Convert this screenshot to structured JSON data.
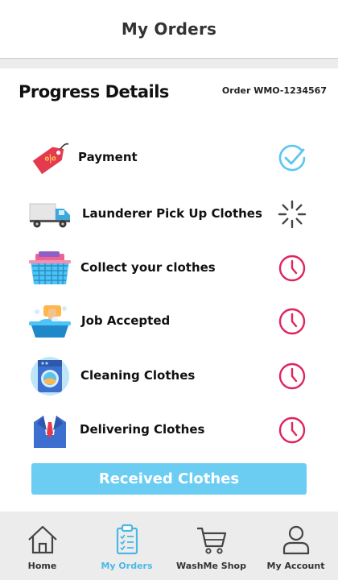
{
  "header": {
    "title": "My Orders"
  },
  "progress": {
    "title": "Progress Details",
    "order_id": "Order WMO-1234567",
    "steps": [
      {
        "label": "Payment",
        "icon": "price-tag-icon",
        "status": "done",
        "status_icon": "check-circle-icon"
      },
      {
        "label": "Launderer Pick Up Clothes",
        "icon": "delivery-truck-icon",
        "status": "in-progress",
        "status_icon": "loading-spinner-icon"
      },
      {
        "label": "Collect your clothes",
        "icon": "laundry-basket-icon",
        "status": "pending",
        "status_icon": "clock-icon"
      },
      {
        "label": "Job Accepted",
        "icon": "washing-tub-icon",
        "status": "pending",
        "status_icon": "clock-icon"
      },
      {
        "label": "Cleaning Clothes",
        "icon": "washing-machine-icon",
        "status": "pending",
        "status_icon": "clock-icon"
      },
      {
        "label": "Delivering Clothes",
        "icon": "suit-icon",
        "status": "pending",
        "status_icon": "clock-icon"
      }
    ],
    "action_button": "Received Clothes"
  },
  "bottom_nav": {
    "items": [
      {
        "label": "Home",
        "icon": "home-icon",
        "active": false
      },
      {
        "label": "My Orders",
        "icon": "clipboard-icon",
        "active": true
      },
      {
        "label": "WashMe Shop",
        "icon": "shopping-cart-icon",
        "active": false
      },
      {
        "label": "My Account",
        "icon": "user-icon",
        "active": false
      }
    ]
  },
  "colors": {
    "accent_blue": "#6ccdf3",
    "done_check": "#5bc6f0",
    "pending_clock": "#e0245e",
    "spinner": "#444444",
    "nav_active": "#4ab8e8"
  }
}
